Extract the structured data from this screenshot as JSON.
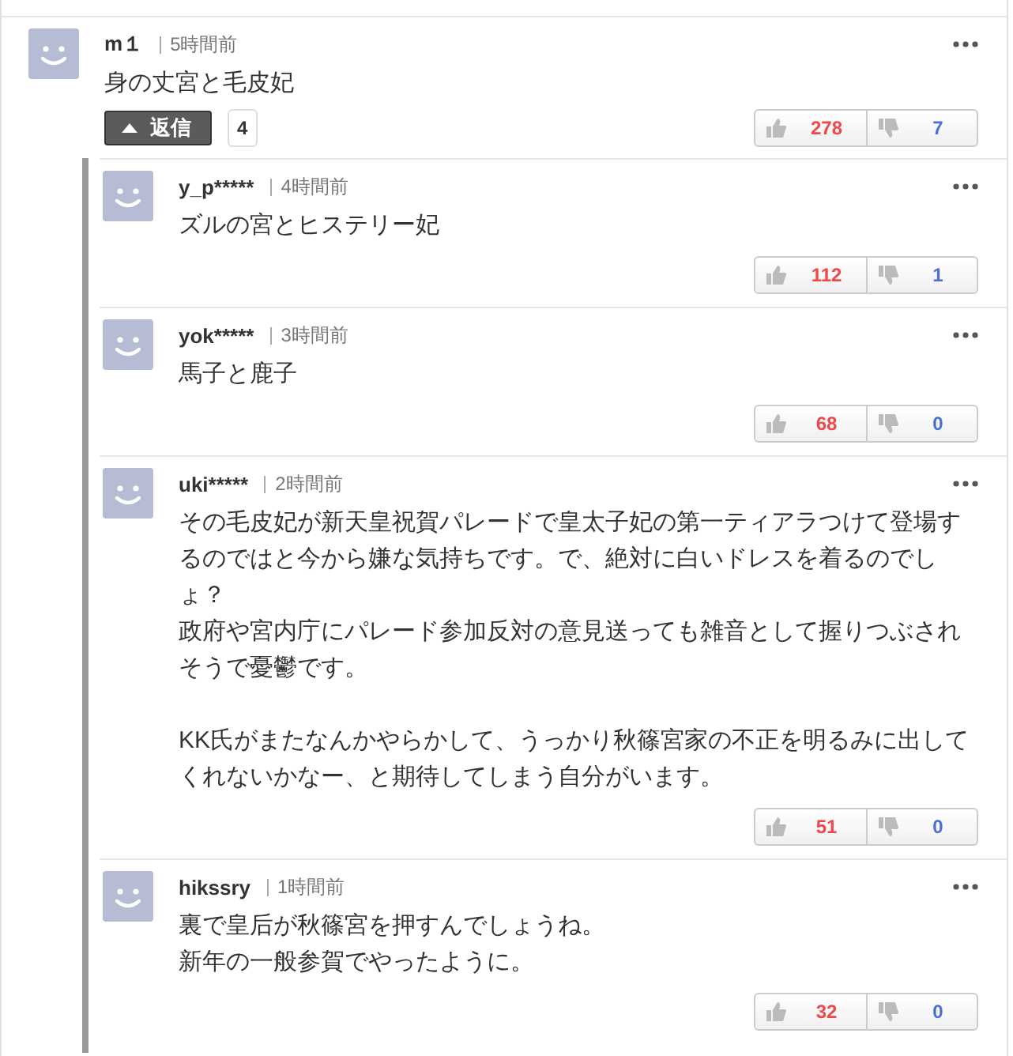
{
  "comment": {
    "author": "m１",
    "time": "5時間前",
    "paragraphs": [
      [
        "身の丈宮と毛皮妃"
      ]
    ],
    "reply_button": {
      "label": "返信",
      "expanded": true
    },
    "reply_count": "4",
    "likes": "278",
    "dislikes": "7"
  },
  "replies": [
    {
      "author": "y_p*****",
      "time": "4時間前",
      "paragraphs": [
        [
          "ズルの宮とヒステリー妃"
        ]
      ],
      "likes": "112",
      "dislikes": "1"
    },
    {
      "author": "yok*****",
      "time": "3時間前",
      "paragraphs": [
        [
          "馬子と鹿子"
        ]
      ],
      "likes": "68",
      "dislikes": "0"
    },
    {
      "author": "uki*****",
      "time": "2時間前",
      "paragraphs": [
        [
          "その毛皮妃が新天皇祝賀パレードで皇太子妃の第一ティアラつけて登場するのではと今から嫌な気持ちです。で、絶対に白いドレスを着るのでしょ？",
          "政府や宮内庁にパレード参加反対の意見送っても雑音として握りつぶされそうで憂鬱です。"
        ],
        [
          "KK氏がまたなんかやらかして、うっかり秋篠宮家の不正を明るみに出してくれないかなー、と期待してしまう自分がいます。"
        ]
      ],
      "likes": "51",
      "dislikes": "0"
    },
    {
      "author": "hikssry",
      "time": "1時間前",
      "paragraphs": [
        [
          "裏で皇后が秋篠宮を押すんでしょうね。",
          "新年の一般参賀でやったように。"
        ]
      ],
      "likes": "32",
      "dislikes": "0"
    }
  ]
}
